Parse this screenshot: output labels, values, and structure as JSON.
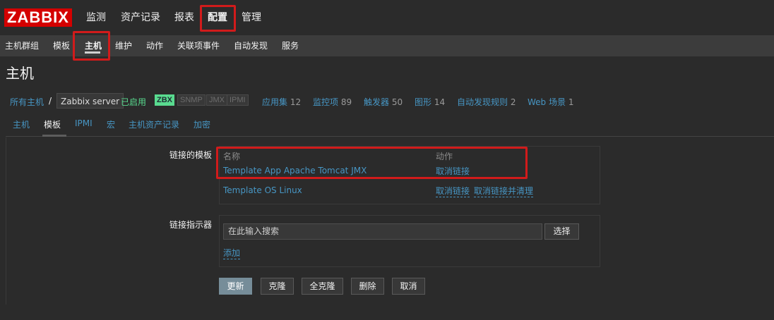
{
  "logo": "ZABBIX",
  "topnav": [
    "监测",
    "资产记录",
    "报表",
    "配置",
    "管理"
  ],
  "subnav": [
    "主机群组",
    "模板",
    "主机",
    "维护",
    "动作",
    "关联项事件",
    "自动发现",
    "服务"
  ],
  "page_title": "主机",
  "filter": {
    "all_hosts": "所有主机",
    "slash": "/",
    "server": "Zabbix server",
    "status": "已启用",
    "badges": [
      "ZBX",
      "SNMP",
      "JMX",
      "IPMI"
    ],
    "links": [
      {
        "label": "应用集",
        "count": "12"
      },
      {
        "label": "监控项",
        "count": "89"
      },
      {
        "label": "触发器",
        "count": "50"
      },
      {
        "label": "图形",
        "count": "14"
      },
      {
        "label": "自动发现规则",
        "count": "2"
      },
      {
        "label": "Web 场景",
        "count": "1"
      }
    ]
  },
  "tabs": [
    "主机",
    "模板",
    "IPMI",
    "宏",
    "主机资产记录",
    "加密"
  ],
  "form": {
    "linked_templates_label": "链接的模板",
    "col_name": "名称",
    "col_action": "动作",
    "templates": [
      {
        "name": "Template App Apache Tomcat JMX",
        "unlink": "取消链接"
      },
      {
        "name": "Template OS Linux",
        "unlink": "取消链接",
        "unlink_clear": "取消链接并清理"
      }
    ],
    "link_indicator_label": "链接指示器",
    "search_placeholder": "在此输入搜索",
    "select_button": "选择",
    "add_link": "添加"
  },
  "buttons": [
    "更新",
    "克隆",
    "全克隆",
    "删除",
    "取消"
  ],
  "colors": {
    "brand": "#d40000",
    "link": "#4796c4",
    "enabled": "#59db8f",
    "highlight": "#d11b1b"
  }
}
